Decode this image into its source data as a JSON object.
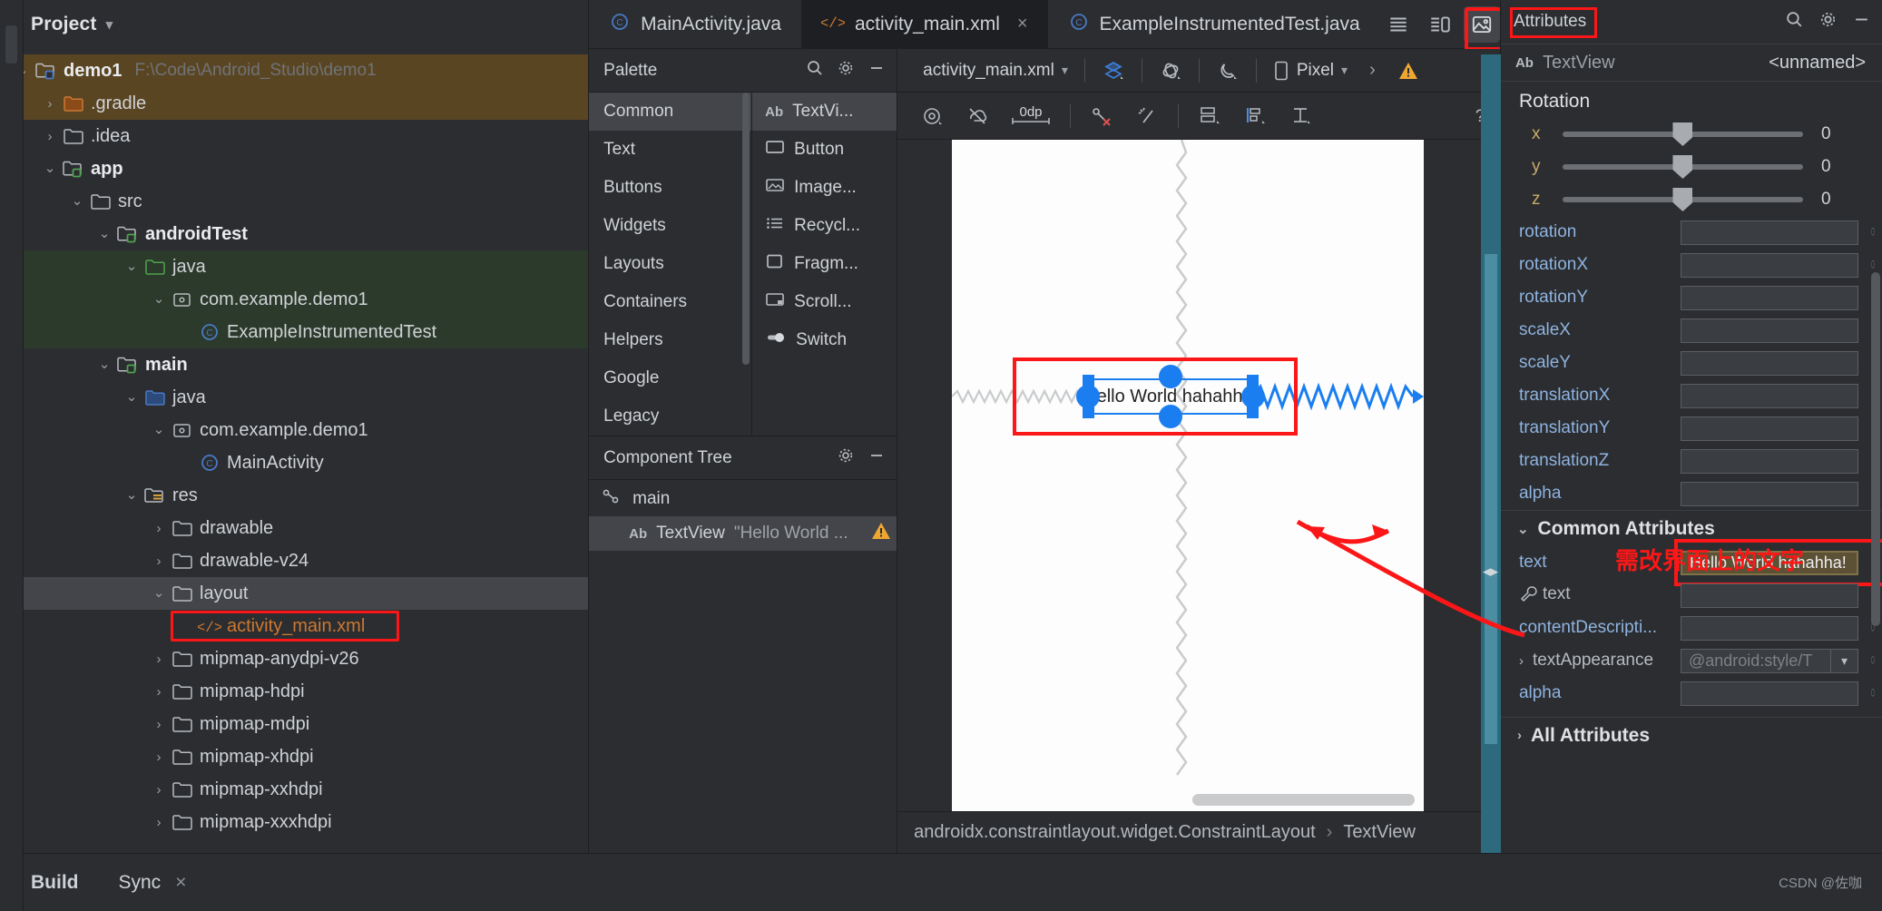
{
  "project": {
    "title": "Project",
    "chevron": "chevron-down",
    "tree": [
      {
        "indent": 0,
        "arrow": "v",
        "icon": "module",
        "label": "demo1",
        "bold": true,
        "path": "F:\\Code\\Android_Studio\\demo1",
        "highlight": "gradle"
      },
      {
        "indent": 1,
        "arrow": ">",
        "icon": "folder-orange",
        "label": ".gradle",
        "highlight": "gradle"
      },
      {
        "indent": 1,
        "arrow": ">",
        "icon": "folder",
        "label": ".idea"
      },
      {
        "indent": 1,
        "arrow": "v",
        "icon": "module-green",
        "label": "app",
        "bold": true
      },
      {
        "indent": 2,
        "arrow": "v",
        "icon": "folder",
        "label": "src"
      },
      {
        "indent": 3,
        "arrow": "v",
        "icon": "module-green",
        "label": "androidTest",
        "bold": true
      },
      {
        "indent": 4,
        "arrow": "v",
        "icon": "folder-green",
        "label": "java",
        "highlight": "green"
      },
      {
        "indent": 5,
        "arrow": "v",
        "icon": "package",
        "label": "com.example.demo1",
        "highlight": "green"
      },
      {
        "indent": 6,
        "arrow": "",
        "icon": "class",
        "label": "ExampleInstrumentedTest",
        "highlight": "green"
      },
      {
        "indent": 3,
        "arrow": "v",
        "icon": "module-green",
        "label": "main",
        "bold": true
      },
      {
        "indent": 4,
        "arrow": "v",
        "icon": "folder-blue",
        "label": "java"
      },
      {
        "indent": 5,
        "arrow": "v",
        "icon": "package",
        "label": "com.example.demo1"
      },
      {
        "indent": 6,
        "arrow": "",
        "icon": "class",
        "label": "MainActivity"
      },
      {
        "indent": 4,
        "arrow": "v",
        "icon": "folder-res",
        "label": "res"
      },
      {
        "indent": 5,
        "arrow": ">",
        "icon": "folder",
        "label": "drawable"
      },
      {
        "indent": 5,
        "arrow": ">",
        "icon": "folder",
        "label": "drawable-v24"
      },
      {
        "indent": 5,
        "arrow": "v",
        "icon": "folder",
        "label": "layout",
        "highlight": "grey"
      },
      {
        "indent": 6,
        "arrow": "",
        "icon": "xml",
        "label": "activity_main.xml",
        "orange": true,
        "redbox": true
      },
      {
        "indent": 5,
        "arrow": ">",
        "icon": "folder",
        "label": "mipmap-anydpi-v26"
      },
      {
        "indent": 5,
        "arrow": ">",
        "icon": "folder",
        "label": "mipmap-hdpi"
      },
      {
        "indent": 5,
        "arrow": ">",
        "icon": "folder",
        "label": "mipmap-mdpi"
      },
      {
        "indent": 5,
        "arrow": ">",
        "icon": "folder",
        "label": "mipmap-xhdpi"
      },
      {
        "indent": 5,
        "arrow": ">",
        "icon": "folder",
        "label": "mipmap-xxhdpi"
      },
      {
        "indent": 5,
        "arrow": ">",
        "icon": "folder",
        "label": "mipmap-xxxhdpi"
      }
    ]
  },
  "tabs": [
    {
      "label": "MainActivity.java",
      "icon": "java-class-icon",
      "active": false,
      "closable": false
    },
    {
      "label": "activity_main.xml",
      "icon": "xml-icon",
      "active": true,
      "closable": true,
      "close": "×"
    },
    {
      "label": "ExampleInstrumentedTest.java",
      "icon": "java-class-icon",
      "active": false,
      "closable": false
    }
  ],
  "top_right_icons": [
    {
      "name": "list-view-icon",
      "glyph": "☰",
      "active": false
    },
    {
      "name": "split-view-icon",
      "glyph": "⌸",
      "active": false
    },
    {
      "name": "design-view-icon",
      "glyph": "ὛC",
      "active": true
    },
    {
      "name": "more-options-icon",
      "glyph": "⋮",
      "active": false
    }
  ],
  "palette": {
    "title": "Palette",
    "search_icon": "search-icon",
    "gear_icon": "gear-icon",
    "minimize_icon": "minimize-icon",
    "categories": [
      "Common",
      "Text",
      "Buttons",
      "Widgets",
      "Layouts",
      "Containers",
      "Helpers",
      "Google",
      "Legacy"
    ],
    "active_category": "Common",
    "items": [
      {
        "label": "TextVi...",
        "icon": "ab-icon",
        "active": true
      },
      {
        "label": "Button",
        "icon": "button-icon",
        "active": false
      },
      {
        "label": "Image...",
        "icon": "image-icon",
        "active": false
      },
      {
        "label": "Recycl...",
        "icon": "recycler-icon",
        "active": false
      },
      {
        "label": "Fragm...",
        "icon": "fragment-icon",
        "active": false
      },
      {
        "label": "Scroll...",
        "icon": "scrollview-icon",
        "active": false
      },
      {
        "label": "Switch",
        "icon": "switch-icon",
        "active": false
      }
    ]
  },
  "component_tree": {
    "title": "Component Tree",
    "gear_icon": "gear-icon",
    "minimize_icon": "minimize-icon",
    "rows": [
      {
        "label": "main",
        "icon": "constraintlayout-icon",
        "selected": false,
        "warning": false
      },
      {
        "label": "TextView",
        "sublabel": "\"Hello World ...",
        "icon": "ab-icon",
        "selected": true,
        "warning": true
      }
    ]
  },
  "design_toolbar": {
    "file_label": "activity_main.xml",
    "dropdown_icon": "chevron-down-icon",
    "design_mode_icon": "design-surface-icon",
    "orientation_icon": "rotate-icon",
    "theme_icon": "night-mode-icon",
    "device_icon": "phone-icon",
    "device_label": "Pixel",
    "more_icon": "chevron-right-icon",
    "warning_icon": "warning-icon"
  },
  "constraint_toolbar": [
    {
      "name": "show-constraints-icon",
      "glyph": "◎"
    },
    {
      "name": "autoconnect-icon",
      "glyph": "☁"
    },
    {
      "name": "default-margin-icon",
      "glyph": "0dp"
    },
    {
      "name": "clear-constraints-icon",
      "glyph": "⛓"
    },
    {
      "name": "infer-constraints-icon",
      "glyph": "✨"
    },
    {
      "name": "pack-icon",
      "glyph": "☰"
    },
    {
      "name": "align-icon",
      "glyph": "▌"
    },
    {
      "name": "guidelines-icon",
      "glyph": "⊥"
    },
    {
      "name": "help-icon",
      "glyph": "?"
    }
  ],
  "canvas": {
    "widget_text": "Hello World hahahha!",
    "selection_handles": 8,
    "constraint_color": "#1a7ef0"
  },
  "breadcrumb": {
    "root": "androidx.constraintlayout.widget.ConstraintLayout",
    "separator": "›",
    "leaf": "TextView"
  },
  "attributes": {
    "title": "Attributes",
    "search_icon": "search-icon",
    "gear_icon": "gear-icon",
    "minimize_icon": "minimize-icon",
    "component_icon": "ab-icon",
    "component_type": "TextView",
    "component_id": "<unnamed>",
    "rotation_label": "Rotation",
    "rotation": [
      {
        "axis": "x",
        "value": "0"
      },
      {
        "axis": "y",
        "value": "0"
      },
      {
        "axis": "z",
        "value": "0"
      }
    ],
    "rows": [
      {
        "name": "rotation",
        "value": "",
        "kind": "text"
      },
      {
        "name": "rotationX",
        "value": "",
        "kind": "text"
      },
      {
        "name": "rotationY",
        "value": "",
        "kind": "text"
      },
      {
        "name": "scaleX",
        "value": "",
        "kind": "text"
      },
      {
        "name": "scaleY",
        "value": "",
        "kind": "text"
      },
      {
        "name": "translationX",
        "value": "",
        "kind": "text"
      },
      {
        "name": "translationY",
        "value": "",
        "kind": "text"
      },
      {
        "name": "translationZ",
        "value": "",
        "kind": "text"
      },
      {
        "name": "alpha",
        "value": "",
        "kind": "text"
      }
    ],
    "common_section": {
      "label": "Common Attributes",
      "expander": "chevron-down-icon",
      "rows": [
        {
          "name": "text",
          "value": "Hello World hahahha!",
          "kind": "text",
          "selected": true,
          "redbox": true
        },
        {
          "name": "text",
          "value": "",
          "kind": "text",
          "wrench": true
        },
        {
          "name": "contentDescripti...",
          "value": "",
          "kind": "text"
        },
        {
          "name": "textAppearance",
          "value": "@android:style/T",
          "kind": "combo",
          "expander": "chevron-right-icon",
          "dim": true
        },
        {
          "name": "alpha",
          "value": "",
          "kind": "text"
        }
      ]
    },
    "all_section": {
      "label": "All Attributes",
      "expander": "chevron-right-icon"
    }
  },
  "annotations": {
    "chinese_note": "需改界面上的文字"
  },
  "bottom_bar": {
    "items": [
      {
        "label": "Build",
        "bold": true,
        "close": false
      },
      {
        "label": "Sync",
        "bold": false,
        "close": true,
        "close_glyph": "×"
      }
    ],
    "watermark": "CSDN @佐咖"
  },
  "colors": {
    "bg": "#2b2d30",
    "panel": "#1e1f22",
    "accent_red": "#fb1717",
    "accent_blue": "#1a7ef0",
    "selection_grey": "#43454a",
    "orange": "#cc7832",
    "teal": "#2d6a7d"
  }
}
